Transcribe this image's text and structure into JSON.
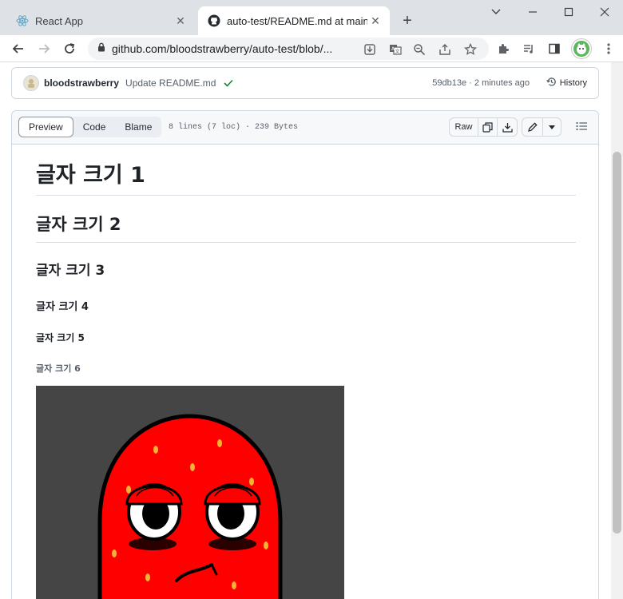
{
  "browser": {
    "tabs": [
      {
        "title": "React App",
        "favicon": "react-icon",
        "active": false
      },
      {
        "title": "auto-test/README.md at main",
        "favicon": "github-icon",
        "active": true
      }
    ],
    "new_tab": "+",
    "url": "github.com/bloodstrawberry/auto-test/blob/...",
    "window_controls": [
      "chevron-down-icon",
      "minimize-icon",
      "maximize-icon",
      "close-icon"
    ]
  },
  "commit": {
    "author": "bloodstrawberry",
    "message": "Update README.md",
    "status": "success",
    "sha_time": "59db13e · 2 minutes ago",
    "history_label": "History"
  },
  "file_header": {
    "views": [
      "Preview",
      "Code",
      "Blame"
    ],
    "active_view": "Preview",
    "info": "8 lines (7 loc) · 239 Bytes",
    "raw_label": "Raw"
  },
  "markdown": {
    "h1": "글자 크기 1",
    "h2": "글자 크기 2",
    "h3": "글자 크기 3",
    "h4": "글자 크기 4",
    "h5": "글자 크기 5",
    "h6": "글자 크기 6"
  },
  "colors": {
    "strawberry": "#ff0000",
    "seeds": "#f2b233",
    "image_bg": "#454545",
    "success": "#1a7f37"
  }
}
